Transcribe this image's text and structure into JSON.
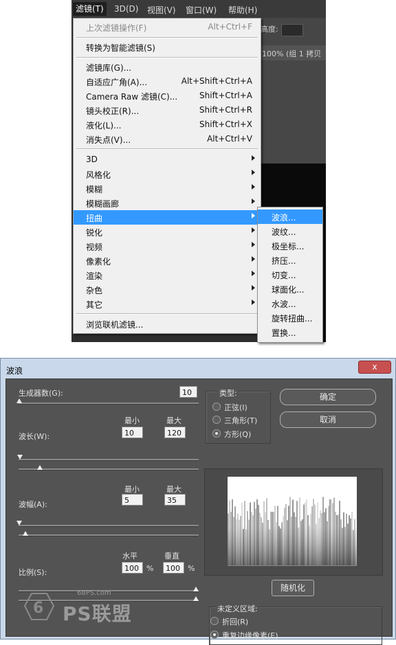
{
  "menubar": {
    "items": [
      "滤镜(T)",
      "3D(D)",
      "视图(V)",
      "窗口(W)",
      "帮助(H)"
    ]
  },
  "options_bar": {
    "label": "高度:"
  },
  "document_tab": {
    "label": "100% (组 1 拷贝"
  },
  "filter_menu": {
    "items": [
      {
        "label": "上次滤镜操作(F)",
        "shortcut": "Alt+Ctrl+F"
      },
      {
        "label": "转换为智能滤镜(S)",
        "shortcut": ""
      },
      {
        "label": "滤镜库(G)...",
        "shortcut": ""
      },
      {
        "label": "自适应广角(A)...",
        "shortcut": "Alt+Shift+Ctrl+A"
      },
      {
        "label": "Camera Raw 滤镜(C)...",
        "shortcut": "Shift+Ctrl+A"
      },
      {
        "label": "镜头校正(R)...",
        "shortcut": "Shift+Ctrl+R"
      },
      {
        "label": "液化(L)...",
        "shortcut": "Shift+Ctrl+X"
      },
      {
        "label": "消失点(V)...",
        "shortcut": "Alt+Ctrl+V"
      },
      {
        "label": "3D",
        "shortcut": ""
      },
      {
        "label": "风格化",
        "shortcut": ""
      },
      {
        "label": "模糊",
        "shortcut": ""
      },
      {
        "label": "模糊画廊",
        "shortcut": ""
      },
      {
        "label": "扭曲",
        "shortcut": ""
      },
      {
        "label": "锐化",
        "shortcut": ""
      },
      {
        "label": "视频",
        "shortcut": ""
      },
      {
        "label": "像素化",
        "shortcut": ""
      },
      {
        "label": "渲染",
        "shortcut": ""
      },
      {
        "label": "杂色",
        "shortcut": ""
      },
      {
        "label": "其它",
        "shortcut": ""
      },
      {
        "label": "浏览联机滤镜...",
        "shortcut": ""
      }
    ]
  },
  "distort_submenu": {
    "items": [
      "波浪...",
      "波纹...",
      "极坐标...",
      "挤压...",
      "切变...",
      "球面化...",
      "水波...",
      "旋转扭曲...",
      "置换..."
    ]
  },
  "wave_dialog": {
    "title": "波浪",
    "close_label": "x",
    "generators": {
      "label": "生成器数(G):",
      "value": "10"
    },
    "min_label": "最小",
    "max_label": "最大",
    "wavelength": {
      "label": "波长(W):",
      "min": "10",
      "max": "120"
    },
    "amplitude": {
      "label": "波幅(A):",
      "min": "5",
      "max": "35"
    },
    "scale": {
      "label": "比例(S):",
      "horizontal_label": "水平",
      "vertical_label": "垂直",
      "horizontal": "100",
      "vertical": "100",
      "unit": "%"
    },
    "type": {
      "label": "类型:",
      "options": [
        "正弦(I)",
        "三角形(T)",
        "方形(Q)"
      ],
      "selected": "方形(Q)"
    },
    "ok_label": "确定",
    "cancel_label": "取消",
    "randomize_label": "随机化",
    "undefined_areas": {
      "label": "未定义区域:",
      "options": [
        "折回(R)",
        "重复边缘像素(E)"
      ],
      "selected": "重复边缘像素(E)"
    },
    "watermark": {
      "site": "68PS.com",
      "brand": "PS联盟"
    }
  }
}
